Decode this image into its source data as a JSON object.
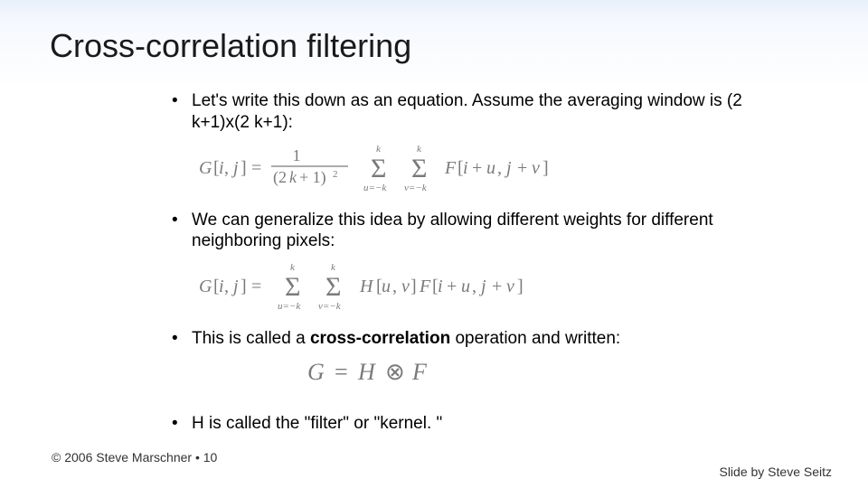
{
  "title": "Cross-correlation filtering",
  "bullets": {
    "b1": "Let's write this down as an equation.  Assume the averaging window is (2 k+1)x(2 k+1):",
    "b2": "We can generalize this idea by allowing different weights for different neighboring pixels:",
    "b3a": "This is called a ",
    "b3b": "cross-correlation",
    "b3c": " operation and written:",
    "b4": "H is called the \"filter\" or \"kernel. \""
  },
  "formulas": {
    "f1": "G[i, j] = 1 / (2k + 1)^2  ·  Σ_{u=-k}^{k} Σ_{v=-k}^{k}  F[i + u, j + v]",
    "f2": "G[i, j] = Σ_{u=-k}^{k} Σ_{v=-k}^{k}  H[u, v] F[i + u, j + v]",
    "f3": "G = H ⊗ F"
  },
  "footer": {
    "left": "© 2006 Steve Marschner • 10",
    "right": "Slide by Steve Seitz"
  }
}
